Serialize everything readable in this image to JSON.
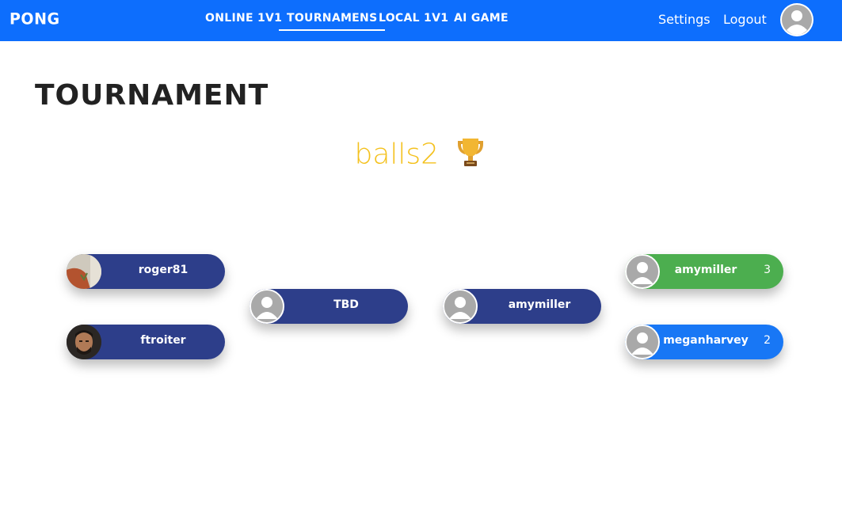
{
  "navbar": {
    "brand": "PONG",
    "links": [
      "ONLINE 1V1",
      "TOURNAMENS",
      "LOCAL 1V1",
      "AI GAME"
    ],
    "active_link": "TOURNAMENS",
    "settings": "Settings",
    "logout": "Logout",
    "avatar_icon": "default-user-avatar-icon"
  },
  "page": {
    "title": "TOURNAMENT",
    "tournament_name": "balls2",
    "trophy_icon": "trophy-icon"
  },
  "bracket": {
    "left_round1": [
      {
        "name": "roger81",
        "avatar": "photo"
      },
      {
        "name": "ftroiter",
        "avatar": "photo"
      }
    ],
    "left_final": {
      "name": "TBD",
      "avatar": "default"
    },
    "right_final": {
      "name": "amymiller",
      "avatar": "default"
    },
    "right_round1": [
      {
        "name": "amymiller",
        "score": "3",
        "status": "winner",
        "avatar": "default"
      },
      {
        "name": "meganharvey",
        "score": "2",
        "status": "loser",
        "avatar": "default"
      }
    ]
  },
  "colors": {
    "navbar": "#0d6efd",
    "pill": "#2d3e8a",
    "winner": "#4cae4f",
    "loser": "#1877f5",
    "tournament_name": "#f4c11d"
  }
}
